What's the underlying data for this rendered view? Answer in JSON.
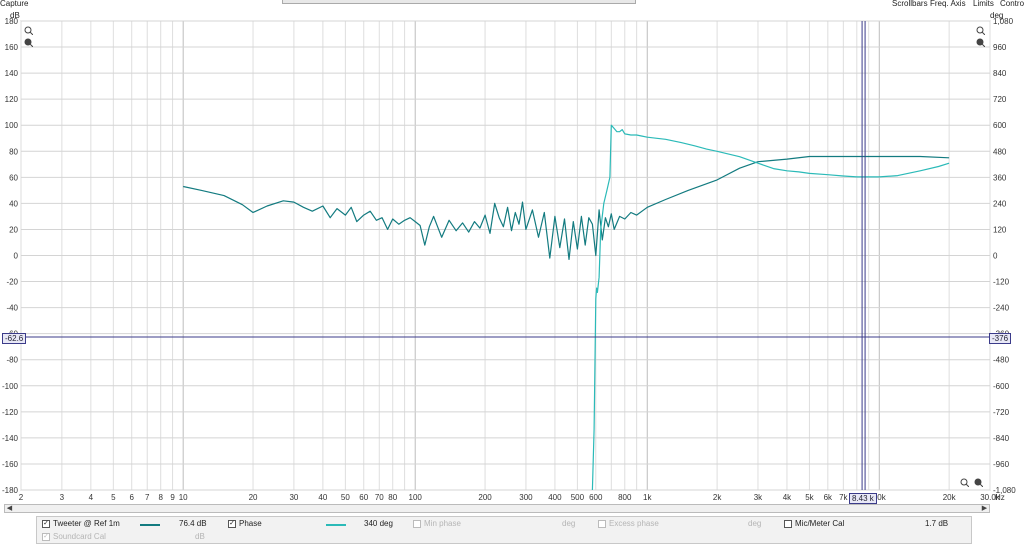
{
  "window": {
    "title": "Capture",
    "menu": [
      "Scrollbars",
      "Freq. Axis",
      "Limits",
      "Controls"
    ]
  },
  "axis_units": {
    "left": "dB",
    "right": "deg",
    "bottom": "Hz"
  },
  "cursor": {
    "left_value": "-62.6",
    "right_value": "-376",
    "freq_value": "8.43 k"
  },
  "legend": {
    "row1": [
      {
        "label": "Tweeter @ Ref 1m",
        "value": "76.4 dB",
        "checked": true,
        "enabled": true,
        "color": "#137b80"
      },
      {
        "label": "Phase",
        "value": "340 deg",
        "checked": true,
        "enabled": true,
        "color": "#2bbab8"
      },
      {
        "label": "Min phase",
        "value": "deg",
        "checked": false,
        "enabled": false
      },
      {
        "label": "Excess phase",
        "value": "deg",
        "checked": false,
        "enabled": false
      },
      {
        "label": "Mic/Meter Cal",
        "value": "1.7 dB",
        "checked": false,
        "enabled": true
      }
    ],
    "row2": [
      {
        "label": "Soundcard Cal",
        "value": "dB",
        "checked": true,
        "enabled": false
      }
    ]
  },
  "chart_data": {
    "type": "line",
    "xscale": "log",
    "xlim": [
      2,
      30000
    ],
    "ylim": [
      -180,
      180
    ],
    "y2lim": [
      -1080,
      1080
    ],
    "x_ticks": [
      "2",
      "3",
      "4",
      "5",
      "6",
      "7",
      "8",
      "9",
      "10",
      "20",
      "30",
      "40",
      "50",
      "60",
      "70",
      "80",
      "100",
      "200",
      "300",
      "400",
      "500",
      "600",
      "800",
      "1k",
      "2k",
      "3k",
      "4k",
      "5k",
      "6k",
      "7k",
      "10k",
      "20k",
      "30.0k"
    ],
    "x_tick_values": [
      2,
      3,
      4,
      5,
      6,
      7,
      8,
      9,
      10,
      20,
      30,
      40,
      50,
      60,
      70,
      80,
      100,
      200,
      300,
      400,
      500,
      600,
      800,
      1000,
      2000,
      3000,
      4000,
      5000,
      6000,
      7000,
      10000,
      20000,
      30000
    ],
    "y_ticks": [
      "180",
      "160",
      "140",
      "120",
      "100",
      "80",
      "60",
      "40",
      "20",
      "0",
      "-20",
      "-40",
      "-60",
      "-80",
      "-100",
      "-120",
      "-140",
      "-160",
      "-180"
    ],
    "y_tick_values": [
      180,
      160,
      140,
      120,
      100,
      80,
      60,
      40,
      20,
      0,
      -20,
      -40,
      -60,
      -80,
      -100,
      -120,
      -140,
      -160,
      -180
    ],
    "y2_ticks": [
      "1,080",
      "960",
      "840",
      "720",
      "600",
      "480",
      "360",
      "240",
      "120",
      "0",
      "-120",
      "-240",
      "-360",
      "-480",
      "-600",
      "-720",
      "-840",
      "-960",
      "-1,080"
    ],
    "y2_tick_values": [
      1080,
      960,
      840,
      720,
      600,
      480,
      360,
      240,
      120,
      0,
      -120,
      -240,
      -360,
      -480,
      -600,
      -720,
      -840,
      -960,
      -1080
    ],
    "grid": true,
    "cursor_x": 8430,
    "cursor_y": -62.6,
    "series": [
      {
        "name": "Tweeter @ Ref 1m",
        "color": "#137b80",
        "axis": "left",
        "x": [
          10,
          12,
          15,
          18,
          20,
          23,
          27,
          30,
          33,
          36,
          40,
          43,
          46,
          50,
          53,
          56,
          60,
          64,
          68,
          72,
          76,
          80,
          85,
          90,
          95,
          100,
          105,
          110,
          115,
          120,
          130,
          140,
          150,
          160,
          170,
          180,
          190,
          200,
          210,
          220,
          230,
          240,
          250,
          260,
          270,
          280,
          290,
          300,
          320,
          340,
          360,
          380,
          400,
          420,
          440,
          460,
          480,
          500,
          520,
          540,
          560,
          580,
          600,
          620,
          640,
          660,
          680,
          700,
          720,
          760,
          800,
          850,
          900,
          1000,
          1200,
          1500,
          2000,
          2500,
          3000,
          4000,
          5000,
          6000,
          8000,
          10000,
          15000,
          20000
        ],
        "y": [
          53,
          50,
          46,
          39,
          33,
          38,
          42,
          41,
          37,
          34,
          38,
          29,
          36,
          31,
          37,
          26,
          31,
          34,
          27,
          29,
          20,
          28,
          24,
          27,
          29,
          26,
          23,
          8,
          22,
          30,
          14,
          27,
          19,
          25,
          18,
          26,
          21,
          31,
          17,
          40,
          29,
          22,
          37,
          19,
          33,
          24,
          41,
          20,
          35,
          14,
          33,
          -2,
          30,
          6,
          28,
          -3,
          26,
          5,
          30,
          8,
          29,
          24,
          0,
          35,
          12,
          29,
          22,
          32,
          20,
          30,
          28,
          33,
          31,
          37,
          43,
          50,
          58,
          67,
          72,
          74,
          76,
          76,
          76,
          76,
          76,
          75
        ]
      },
      {
        "name": "Phase",
        "color": "#2bbab8",
        "axis": "right",
        "x": [
          580,
          590,
          600,
          605,
          610,
          620,
          630,
          650,
          670,
          690,
          700,
          720,
          740,
          760,
          780,
          800,
          850,
          900,
          950,
          1000,
          1100,
          1200,
          1400,
          1600,
          1800,
          2000,
          2500,
          3000,
          3500,
          4000,
          4500,
          5000,
          6000,
          7000,
          8000,
          10000,
          12000,
          15000,
          18000,
          20000
        ],
        "y": [
          -1080,
          -800,
          -200,
          -150,
          -170,
          -100,
          120,
          240,
          300,
          360,
          600,
          585,
          570,
          570,
          580,
          560,
          555,
          555,
          550,
          545,
          540,
          535,
          520,
          505,
          490,
          480,
          455,
          425,
          400,
          390,
          385,
          378,
          372,
          366,
          362,
          362,
          368,
          390,
          410,
          425
        ]
      }
    ]
  }
}
